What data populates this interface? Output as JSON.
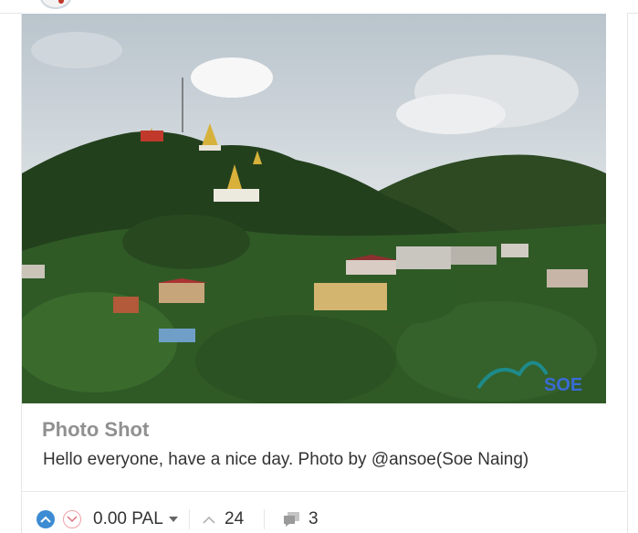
{
  "post": {
    "title": "Photo Shot",
    "body": "Hello everyone, have a nice day. Photo by @ansoe(Soe Naing)",
    "watermark": "SOE"
  },
  "footer": {
    "payout": "0.00 PAL",
    "votes": "24",
    "comments": "3"
  },
  "colors": {
    "upvote": "#3d8bd3",
    "downvote": "#f0a0a8",
    "title": "#909090"
  }
}
